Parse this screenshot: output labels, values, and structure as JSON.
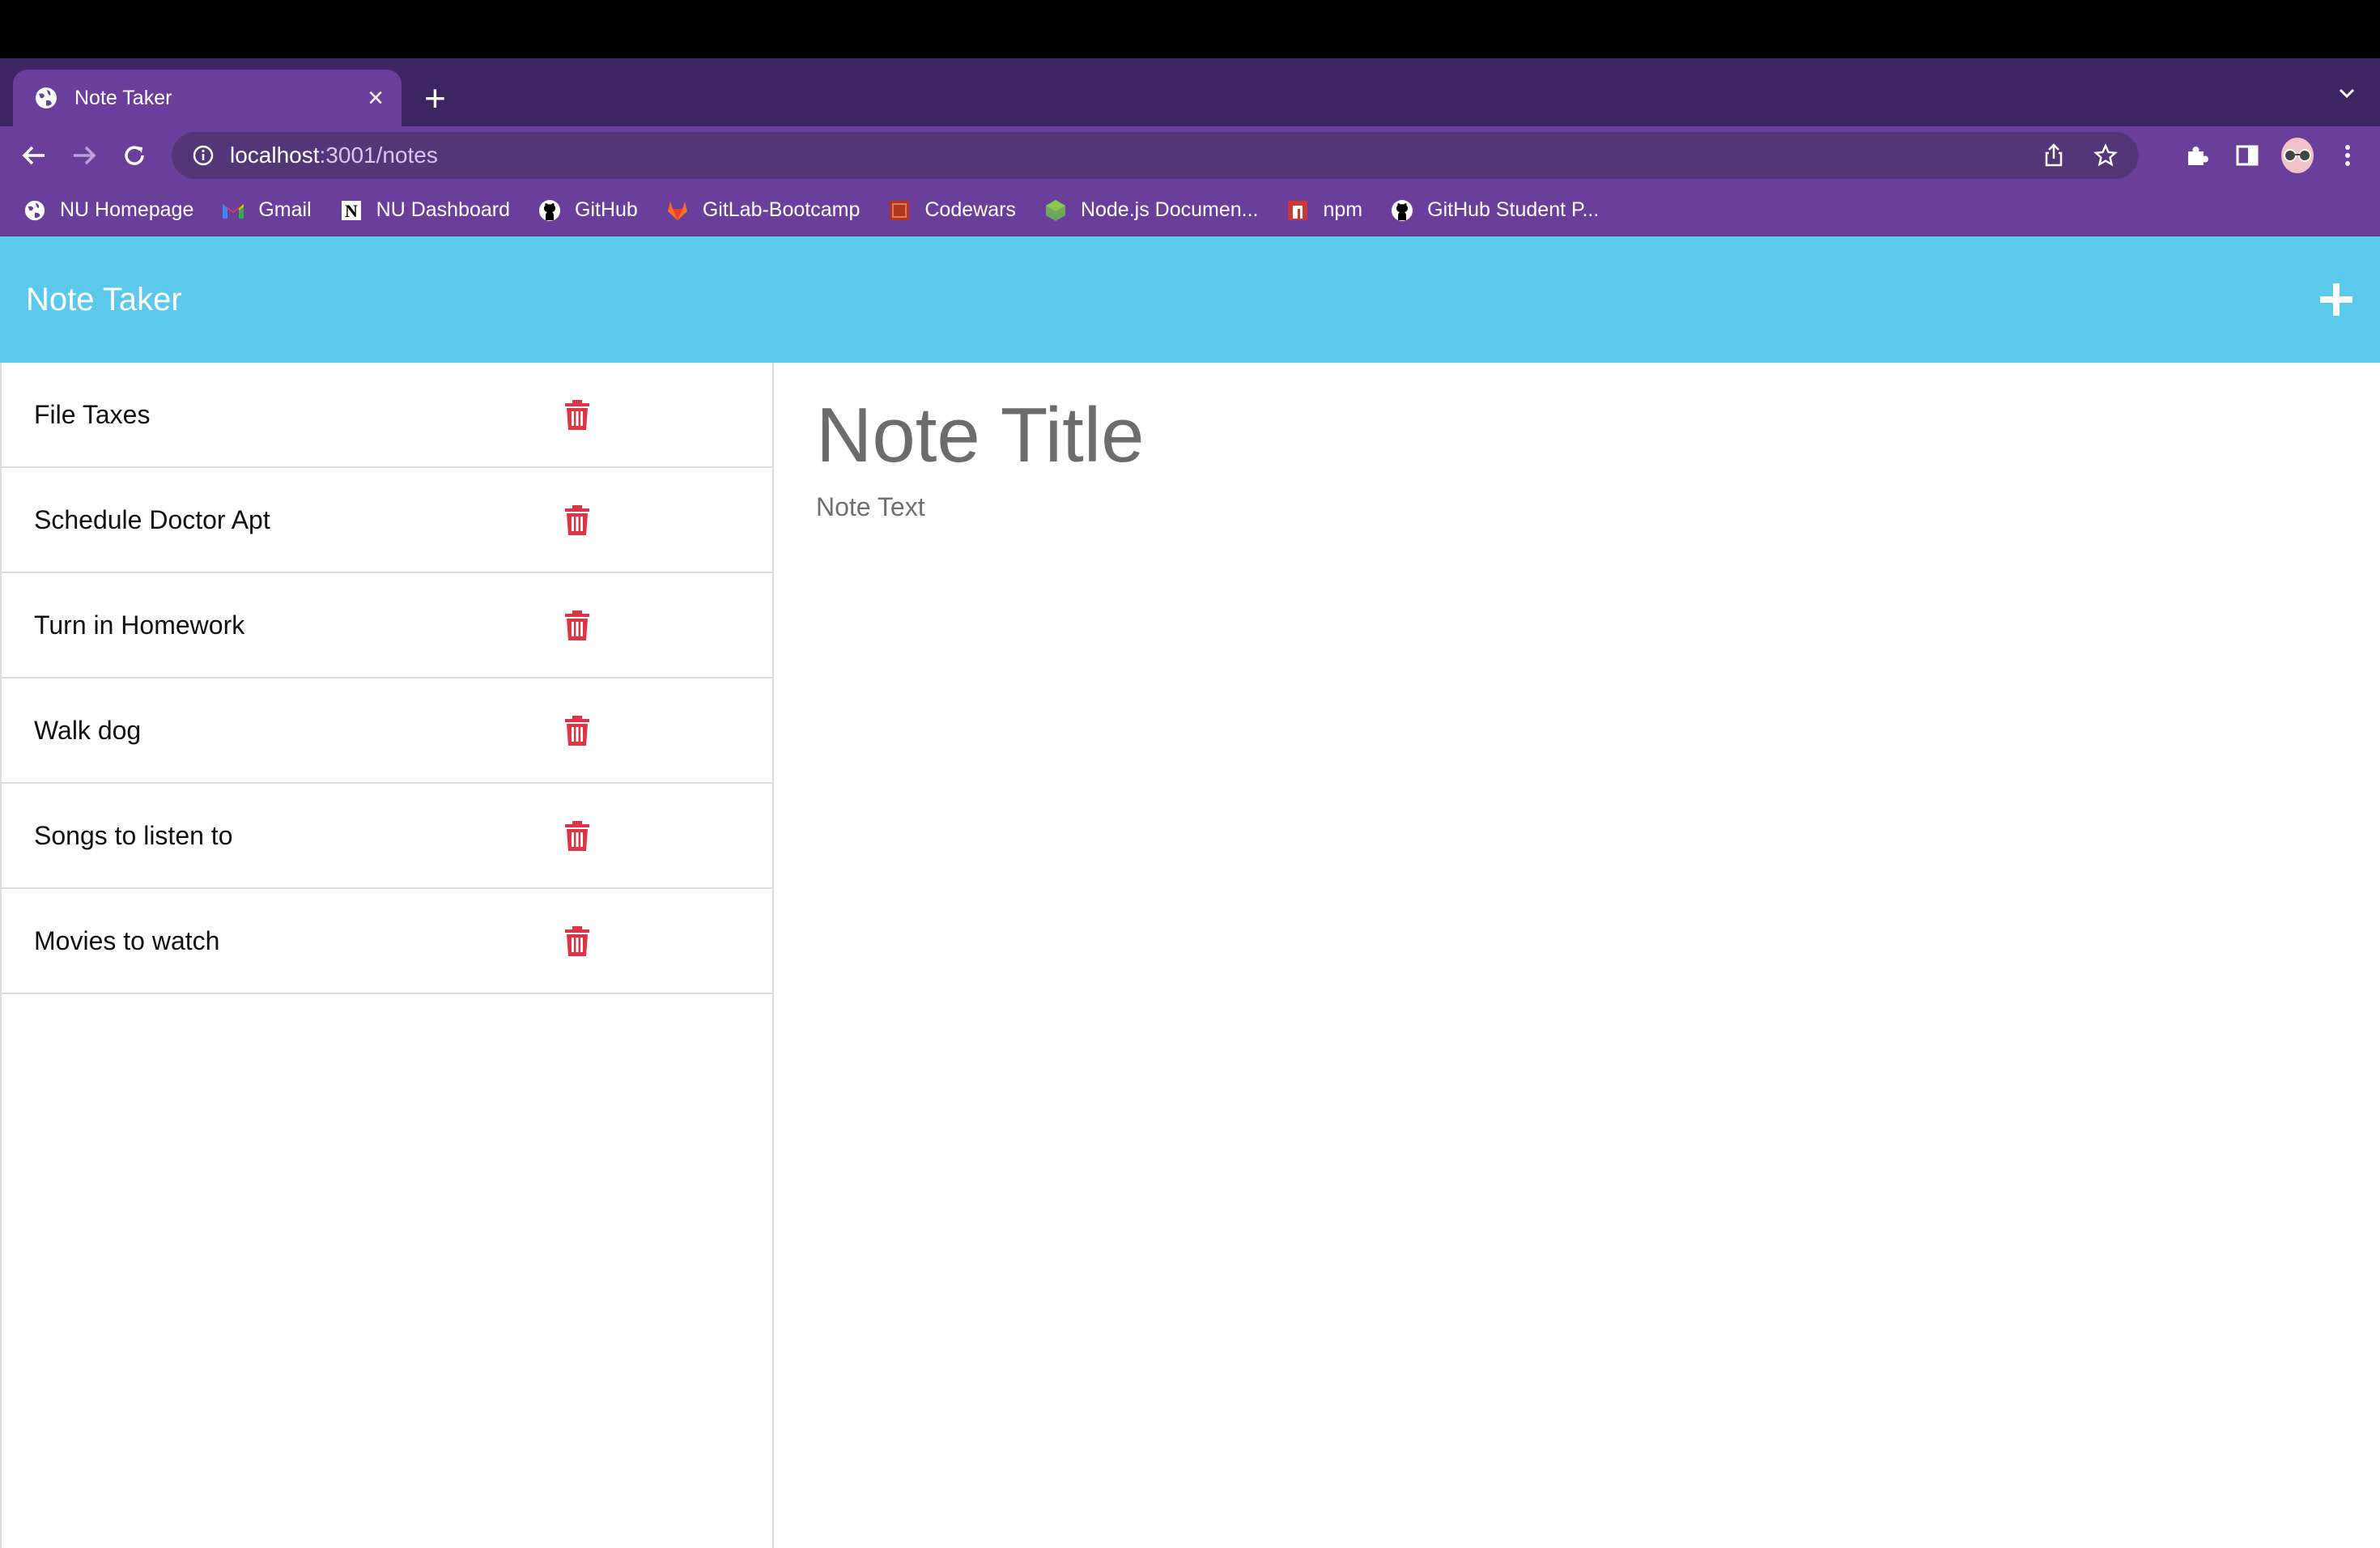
{
  "browser": {
    "tab": {
      "title": "Note Taker"
    },
    "address": {
      "host": "localhost",
      "path": ":3001/notes"
    },
    "bookmarks": [
      {
        "label": "NU Homepage",
        "icon": "globe-icon"
      },
      {
        "label": "Gmail",
        "icon": "gmail-icon"
      },
      {
        "label": "NU Dashboard",
        "icon": "notion-icon"
      },
      {
        "label": "GitHub",
        "icon": "github-icon"
      },
      {
        "label": "GitLab-Bootcamp",
        "icon": "gitlab-icon"
      },
      {
        "label": "Codewars",
        "icon": "codewars-icon"
      },
      {
        "label": "Node.js Documen...",
        "icon": "nodejs-icon"
      },
      {
        "label": "npm",
        "icon": "npm-icon"
      },
      {
        "label": "GitHub Student P...",
        "icon": "github-icon"
      }
    ]
  },
  "app": {
    "title": "Note Taker",
    "notes": [
      {
        "title": "File Taxes"
      },
      {
        "title": "Schedule Doctor Apt"
      },
      {
        "title": "Turn in Homework"
      },
      {
        "title": "Walk dog"
      },
      {
        "title": "Songs to listen to"
      },
      {
        "title": "Movies to watch"
      }
    ],
    "editor": {
      "title_placeholder": "Note Title",
      "text_placeholder": "Note Text"
    }
  },
  "colors": {
    "tab_strip": "#3f2462",
    "browser_chrome": "#6a3f9b",
    "app_navbar": "#5bc8ec",
    "trash": "#dc3545"
  }
}
